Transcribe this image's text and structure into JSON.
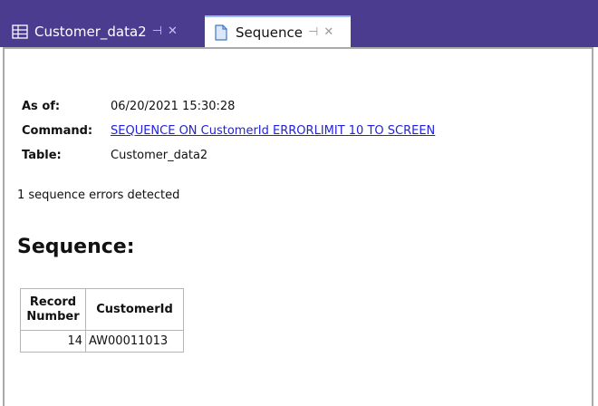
{
  "tabs": [
    {
      "label": "Customer_data2",
      "icon": "table-icon",
      "active": false
    },
    {
      "label": "Sequence",
      "icon": "document-icon",
      "active": true
    }
  ],
  "report": {
    "as_of_label": "As of:",
    "as_of_value": "06/20/2021 15:30:28",
    "command_label": "Command:",
    "command_value": "SEQUENCE ON CustomerId ERRORLIMIT 10 TO SCREEN",
    "table_label": "Table:",
    "table_value": "Customer_data2",
    "errors_text": "1 sequence errors detected",
    "section_title": "Sequence:"
  },
  "table": {
    "headers": [
      "Record Number",
      "CustomerId"
    ],
    "rows": [
      [
        "14",
        "AW00011013"
      ]
    ]
  },
  "colors": {
    "tabbar": "#4b3c8f",
    "link": "#2222dd"
  }
}
